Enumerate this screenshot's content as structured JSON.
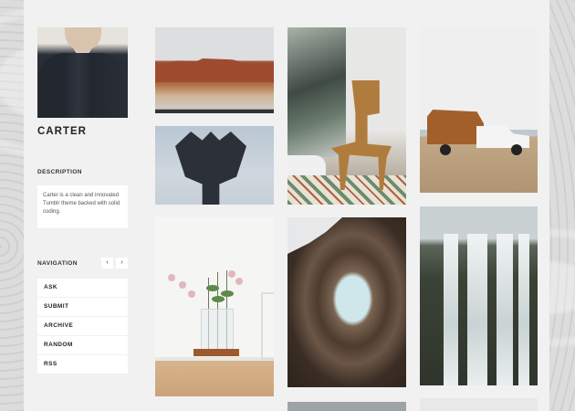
{
  "blog": {
    "title": "CARTER"
  },
  "description": {
    "label": "DESCRIPTION",
    "text": "Carter is a clean and innovated Tumblr theme backed with solid coding."
  },
  "navigation": {
    "label": "NAVIGATION",
    "prev_icon": "chevron-left-icon",
    "next_icon": "chevron-right-icon",
    "prev_glyph": "‹",
    "next_glyph": "›",
    "items": [
      "ASK",
      "SUBMIT",
      "ARCHIVE",
      "RANDOM",
      "RSS"
    ]
  }
}
